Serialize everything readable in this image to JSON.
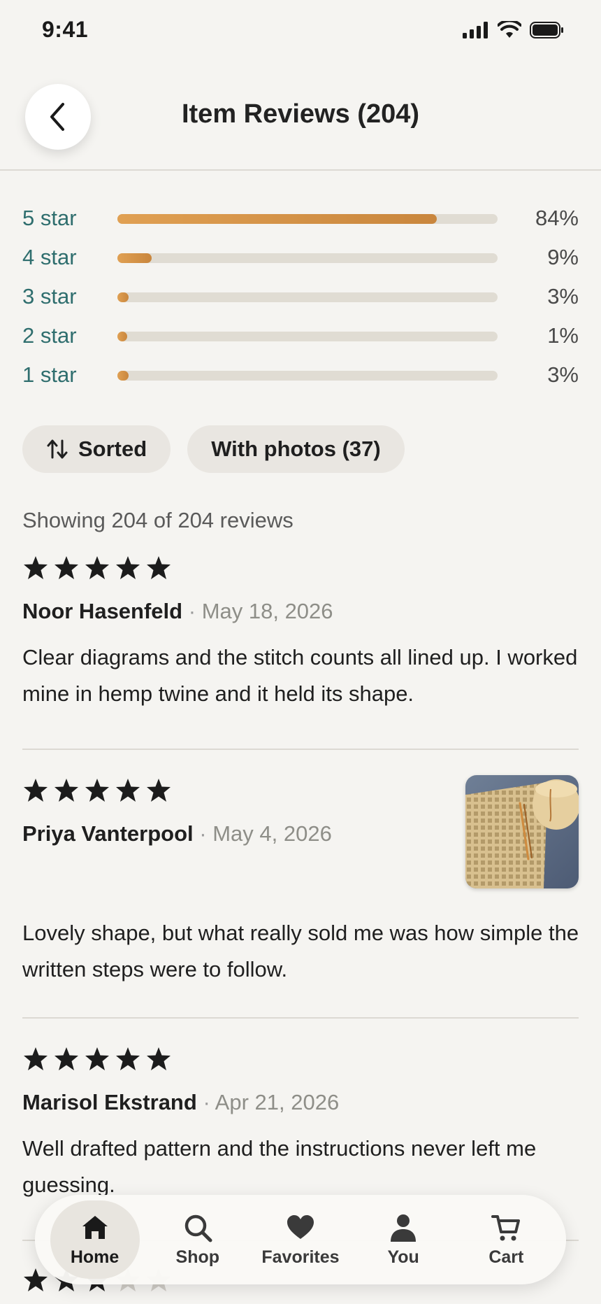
{
  "status_bar": {
    "time": "9:41"
  },
  "header": {
    "title": "Item Reviews (204)"
  },
  "ratings": [
    {
      "label": "5 star",
      "percent_text": "84%",
      "fraction": 0.84
    },
    {
      "label": "4 star",
      "percent_text": "9%",
      "fraction": 0.09
    },
    {
      "label": "3 star",
      "percent_text": "3%",
      "fraction": 0.03
    },
    {
      "label": "2 star",
      "percent_text": "1%",
      "fraction": 0.01
    },
    {
      "label": "1 star",
      "percent_text": "3%",
      "fraction": 0.03
    }
  ],
  "filters": {
    "sorted_label": "Sorted",
    "photos_label": "With photos (37)"
  },
  "showing_text": "Showing 204 of 204 reviews",
  "reviews": [
    {
      "rating": 5,
      "author": "Noor Hasenfeld",
      "separator": "·",
      "date": "May 18, 2026",
      "text": "Clear diagrams and the stitch counts all lined up. I worked mine in hemp twine and it held its shape.",
      "has_photo": false
    },
    {
      "rating": 5,
      "author": "Priya Vanterpool",
      "separator": "·",
      "date": "May 4, 2026",
      "text": "Lovely shape, but what really sold me was how simple the written steps were to follow.",
      "has_photo": true
    },
    {
      "rating": 5,
      "author": "Marisol Ekstrand",
      "separator": "·",
      "date": "Apr 21, 2026",
      "text": "Well drafted pattern and the instructions never left me guessing.",
      "has_photo": false
    },
    {
      "rating": 3,
      "author": "",
      "date": "",
      "text": "",
      "has_photo": false
    }
  ],
  "nav": {
    "items": [
      {
        "label": "Home",
        "icon": "home-icon",
        "active": true
      },
      {
        "label": "Shop",
        "icon": "search-icon",
        "active": false
      },
      {
        "label": "Favorites",
        "icon": "heart-icon",
        "active": false
      },
      {
        "label": "You",
        "icon": "person-icon",
        "active": false
      },
      {
        "label": "Cart",
        "icon": "cart-icon",
        "active": false
      }
    ]
  },
  "colors": {
    "accent_teal": "#2f6e6e",
    "bar_fill": "#d4913f",
    "bar_track": "#e0dcd3",
    "background": "#f5f4f1"
  }
}
